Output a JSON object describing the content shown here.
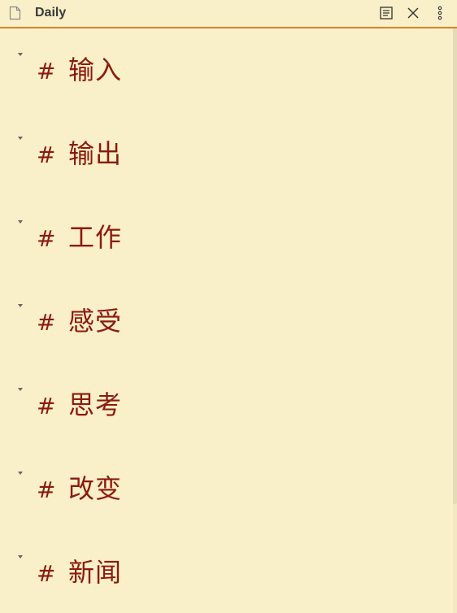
{
  "header": {
    "title": "Daily",
    "icons": {
      "file": "file-icon",
      "reading_view": "reading-view-icon",
      "close": "close-icon",
      "more": "more-options-icon"
    }
  },
  "headings": [
    {
      "marker": "#",
      "text": "输入"
    },
    {
      "marker": "#",
      "text": "输出"
    },
    {
      "marker": "#",
      "text": "工作"
    },
    {
      "marker": "#",
      "text": "感受"
    },
    {
      "marker": "#",
      "text": "思考"
    },
    {
      "marker": "#",
      "text": "改变"
    },
    {
      "marker": "#",
      "text": "新闻"
    }
  ],
  "colors": {
    "background": "#f9efc8",
    "heading": "#8b1a0f",
    "header_border": "#d9822b",
    "title": "#3a3a3a"
  }
}
